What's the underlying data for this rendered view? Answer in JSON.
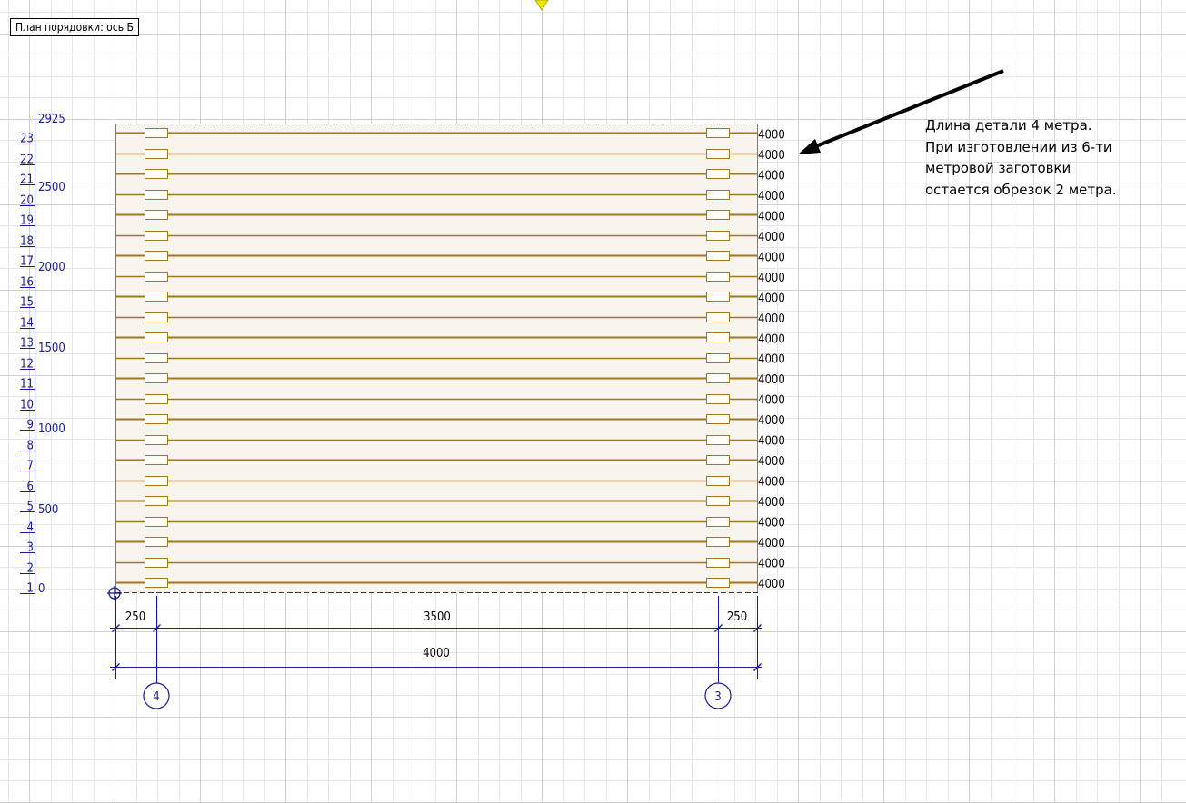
{
  "title": "План порядовки: ось Б",
  "note": {
    "lines": [
      "Длина детали 4 метра.",
      "При изготовлении из 6-ти",
      "метровой заготовки",
      "остается обрезок 2 метра."
    ]
  },
  "course_numbers": [
    "1",
    "2",
    "3",
    "4",
    "5",
    "6",
    "7",
    "8",
    "9",
    "10",
    "11",
    "12",
    "13",
    "14",
    "15",
    "16",
    "17",
    "18",
    "19",
    "20",
    "21",
    "22",
    "23"
  ],
  "height_marks": [
    "0",
    "500",
    "1000",
    "1500",
    "2000",
    "2500",
    "2925"
  ],
  "log_lengths": [
    "4000",
    "4000",
    "4000",
    "4000",
    "4000",
    "4000",
    "4000",
    "4000",
    "4000",
    "4000",
    "4000",
    "4000",
    "4000",
    "4000",
    "4000",
    "4000",
    "4000",
    "4000",
    "4000",
    "4000",
    "4000",
    "4000",
    "4000"
  ],
  "dimensions": {
    "left_offset": "250",
    "span": "3500",
    "right_offset": "250",
    "total": "4000"
  },
  "axes": {
    "left": "4",
    "right": "3"
  },
  "colors": {
    "grid": "#d9d9d9",
    "wall_fill": "#f8f5ee",
    "log_line": "#a07820",
    "annotation_blue": "#1a1a9c",
    "marker_yellow": "#f2e600"
  }
}
